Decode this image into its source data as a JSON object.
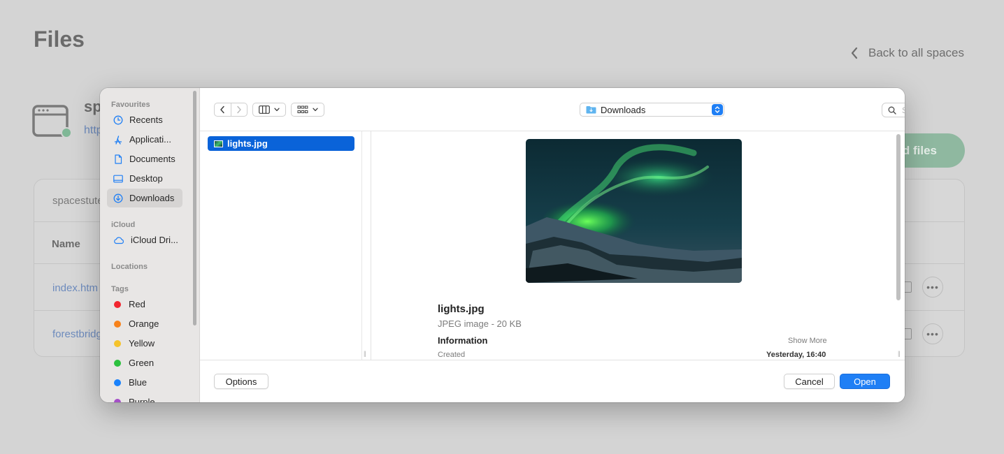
{
  "background": {
    "title": "Files",
    "back_link": "Back to all spaces",
    "space_name": "sp",
    "space_url": "http",
    "upload_button": "d files",
    "table_domain": "spacestute",
    "column_name": "Name",
    "files": [
      "index.htm",
      "forestbridg"
    ]
  },
  "dialog": {
    "sidebar": {
      "favourites_label": "Favourites",
      "favourites": [
        {
          "label": "Recents",
          "icon": "clock-icon"
        },
        {
          "label": "Applicati...",
          "icon": "applications-icon"
        },
        {
          "label": "Documents",
          "icon": "document-icon"
        },
        {
          "label": "Desktop",
          "icon": "desktop-icon"
        },
        {
          "label": "Downloads",
          "icon": "downloads-icon",
          "selected": true
        }
      ],
      "icloud_label": "iCloud",
      "icloud": [
        {
          "label": "iCloud Dri...",
          "icon": "cloud-icon"
        }
      ],
      "locations_label": "Locations",
      "tags_label": "Tags",
      "tags": [
        {
          "label": "Red",
          "color": "#f2262f"
        },
        {
          "label": "Orange",
          "color": "#f7821b"
        },
        {
          "label": "Yellow",
          "color": "#f5c32b"
        },
        {
          "label": "Green",
          "color": "#2cc13e"
        },
        {
          "label": "Blue",
          "color": "#1a82fb"
        },
        {
          "label": "Purple",
          "color": "#a54fc8"
        }
      ]
    },
    "toolbar": {
      "location": "Downloads",
      "search_placeholder": "Search"
    },
    "files": [
      {
        "name": "lights.jpg",
        "selected": true
      }
    ],
    "preview": {
      "name": "lights.jpg",
      "kind": "JPEG image - 20 KB",
      "info_label": "Information",
      "show_more": "Show More",
      "created_label": "Created",
      "created_value": "Yesterday, 16:40"
    },
    "buttons": {
      "options": "Options",
      "cancel": "Cancel",
      "open": "Open"
    },
    "accent_color": "#1f7ff5"
  }
}
